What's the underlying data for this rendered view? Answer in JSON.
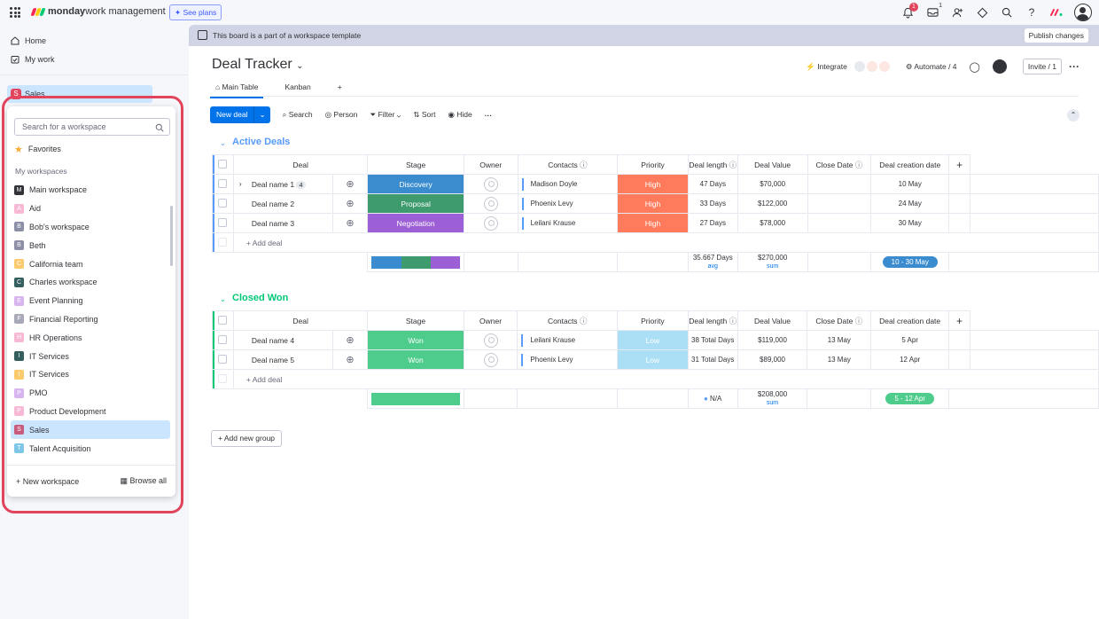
{
  "topbar": {
    "brand_bold": "monday",
    "brand_rest": " work management",
    "see_plans": "See plans",
    "notification_count": "1",
    "inbox_count": "1"
  },
  "sidebar": {
    "home": "Home",
    "my_work": "My work",
    "current_workspace": "Sales",
    "current_workspace_initial": "S"
  },
  "workspace_dropdown": {
    "search_placeholder": "Search for a workspace",
    "favorites": "Favorites",
    "section_label": "My workspaces",
    "workspaces": [
      {
        "initial": "M",
        "name": "Main workspace",
        "color": "#323338"
      },
      {
        "initial": "A",
        "name": "Aid",
        "color": "#f7b8d6"
      },
      {
        "initial": "B",
        "name": "Bob's workspace",
        "color": "#8c8fa5"
      },
      {
        "initial": "B",
        "name": "Beth",
        "color": "#8c8fa5"
      },
      {
        "initial": "C",
        "name": "California team",
        "color": "#fdcb6e"
      },
      {
        "initial": "C",
        "name": "Charles workspace",
        "color": "#355e5e"
      },
      {
        "initial": "E",
        "name": "Event Planning",
        "color": "#d7b3f0"
      },
      {
        "initial": "F",
        "name": "Financial Reporting",
        "color": "#a8a9b8"
      },
      {
        "initial": "H",
        "name": "HR Operations",
        "color": "#f7b8d6"
      },
      {
        "initial": "I",
        "name": "IT Services",
        "color": "#355e5e"
      },
      {
        "initial": "I",
        "name": "IT Services",
        "color": "#fdcb6e"
      },
      {
        "initial": "P",
        "name": "PMO",
        "color": "#d7b3f0"
      },
      {
        "initial": "P",
        "name": "Product Development",
        "color": "#f7b8d6"
      },
      {
        "initial": "S",
        "name": "Sales",
        "color": "#c95b7d"
      },
      {
        "initial": "T",
        "name": "Talent Acquisition",
        "color": "#7fc7e8"
      }
    ],
    "new_workspace": "New workspace",
    "browse_all": "Browse all"
  },
  "banner": {
    "text": "This board is a part of a workspace template",
    "publish": "Publish changes"
  },
  "board": {
    "title": "Deal Tracker",
    "integrate": "Integrate",
    "automate": "Automate / 4",
    "invite": "Invite / 1",
    "tabs": [
      "Main Table",
      "Kanban"
    ],
    "toolbar": {
      "new_deal": "New deal",
      "search": "Search",
      "person": "Person",
      "filter": "Filter",
      "sort": "Sort",
      "hide": "Hide"
    },
    "columns": [
      "Deal",
      "Stage",
      "Owner",
      "Contacts",
      "Priority",
      "Deal length",
      "Deal Value",
      "Close Date",
      "Deal creation date"
    ],
    "add_item": "+ Add deal",
    "add_group": "Add new group",
    "groups": [
      {
        "name": "Active Deals",
        "color": "#579bfc",
        "rows": [
          {
            "deal": "Deal name 1",
            "subitems": "4",
            "stage": "Discovery",
            "stage_color": "#3a8ccf",
            "contact": "Madison Doyle",
            "priority": "High",
            "priority_color": "#ff7b5c",
            "length": "47 Days",
            "value": "$70,000",
            "close": "",
            "created": "10 May"
          },
          {
            "deal": "Deal name 2",
            "subitems": "",
            "stage": "Proposal",
            "stage_color": "#3d9b6e",
            "contact": "Phoenix Levy",
            "priority": "High",
            "priority_color": "#ff7b5c",
            "length": "33 Days",
            "value": "$122,000",
            "close": "",
            "created": "24 May"
          },
          {
            "deal": "Deal name 3",
            "subitems": "",
            "stage": "Negotiation",
            "stage_color": "#9d5fd6",
            "contact": "Leilani Krause",
            "priority": "High",
            "priority_color": "#ff7b5c",
            "length": "27 Days",
            "value": "$78,000",
            "close": "",
            "created": "30 May"
          }
        ],
        "summary": {
          "length": "35.667 Days",
          "length_sub": "avg",
          "value": "$270,000",
          "value_sub": "sum",
          "dates": "10 - 30 May",
          "dates_color": "#3a8ccf"
        }
      },
      {
        "name": "Closed Won",
        "color": "#00c875",
        "rows": [
          {
            "deal": "Deal name 4",
            "subitems": "",
            "stage": "Won",
            "stage_color": "#4ecc8c",
            "contact": "Leilani Krause",
            "priority": "Low",
            "priority_color": "#abdff5",
            "length": "38 Total Days",
            "value": "$119,000",
            "close": "13 May",
            "created": "5 Apr"
          },
          {
            "deal": "Deal name 5",
            "subitems": "",
            "stage": "Won",
            "stage_color": "#4ecc8c",
            "contact": "Phoenix Levy",
            "priority": "Low",
            "priority_color": "#abdff5",
            "length": "31 Total Days",
            "value": "$89,000",
            "close": "13 May",
            "created": "12 Apr"
          }
        ],
        "summary": {
          "length": "N/A",
          "length_sub": "",
          "value": "$208,000",
          "value_sub": "sum",
          "dates": "5 - 12 Apr",
          "dates_color": "#4ecc8c"
        }
      }
    ]
  }
}
